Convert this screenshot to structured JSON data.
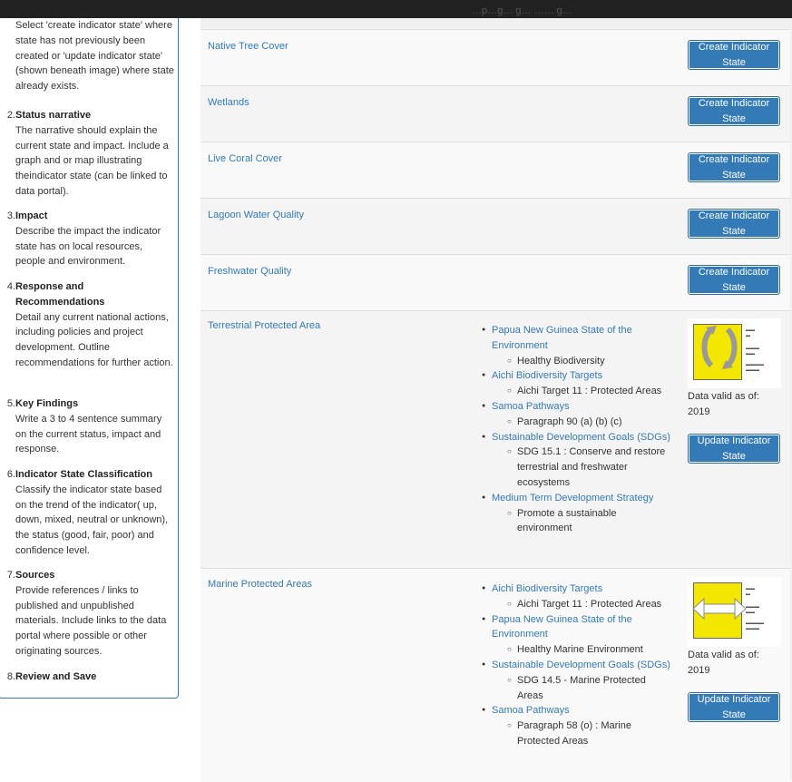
{
  "topbar": {
    "faint_text": "…p…g… g… …… g…"
  },
  "steps": [
    {
      "num": "",
      "title": "",
      "desc": "Select 'create indicator state' where state has not previously been created or 'update indicator state' (shown beneath image) where state already exists."
    },
    {
      "num": "2.",
      "title": "Status narrative",
      "desc": "The narrative should explain the current state and impact. Include a graph and or map illustrating theindicator state (can be linked to data portal)."
    },
    {
      "num": "3.",
      "title": "Impact",
      "desc": "Describe the impact the indicator state has on local resources, people and environment."
    },
    {
      "num": "4.",
      "title": "Response and Recommendations",
      "desc": "Detail any current national actions, including policies and project development. Outline recommendations for further action."
    },
    {
      "num": "5.",
      "title": "Key Findings",
      "desc": "Write a 3 to 4 sentence summary on the current status, impact and response."
    },
    {
      "num": "6.",
      "title": "Indicator State Classification",
      "desc": "Classify the indicator state based on the trend of the indicator( up, down, mixed, neutral or unknown), the status (good, fair, poor) and confidence level."
    },
    {
      "num": "7.",
      "title": "Sources",
      "desc": "Provide references / links to published and unpublished materials. Include links to the data portal where possible or other originating sources."
    },
    {
      "num": "8.",
      "title": "Review and Save",
      "desc": ""
    }
  ],
  "indicators": [
    {
      "name": "Native Tree Cover",
      "button": "Create Indicator State"
    },
    {
      "name": "Wetlands",
      "button": "Create Indicator State"
    },
    {
      "name": "Live Coral Cover",
      "button": "Create Indicator State"
    },
    {
      "name": "Lagoon Water Quality",
      "button": "Create Indicator State"
    },
    {
      "name": "Freshwater Quality",
      "button": "Create Indicator State"
    },
    {
      "name": "Terrestrial Protected Area",
      "button": "Update Indicator State",
      "valid_label": "Data valid as of:",
      "valid_year": "2019",
      "thumb_trend": "mixed",
      "targets": [
        {
          "group": "Papua New Guinea State of the Environment",
          "item": "Healthy Biodiversity"
        },
        {
          "group": "Aichi Biodiversity Targets",
          "item": "Aichi Target 11 : Protected Areas"
        },
        {
          "group": "Samoa Pathways",
          "item": "Paragraph 90 (a) (b) (c)"
        },
        {
          "group": "Sustainable Development Goals (SDGs)",
          "item": "SDG 15.1 : Conserve and restore terrestrial and freshwater ecosystems"
        },
        {
          "group": "Medium Term Development Strategy",
          "item": "Promote a sustainable environment"
        }
      ]
    },
    {
      "name": "Marine Protected Areas",
      "button": "Update Indicator State",
      "valid_label": "Data valid as of:",
      "valid_year": "2019",
      "thumb_trend": "neutral",
      "targets": [
        {
          "group": "Aichi Biodiversity Targets",
          "item": "Aichi Target 11 : Protected Areas"
        },
        {
          "group": "Papua New Guinea State of the Environment",
          "item": "Healthy Marine Environment"
        },
        {
          "group": "Sustainable Development Goals (SDGs)",
          "item": "SDG 14.5 - Marine Protected Areas"
        },
        {
          "group": "Samoa Pathways",
          "item": "Paragraph 58 (o) : Marine Protected Areas"
        }
      ]
    }
  ],
  "colors": {
    "link": "#337ab7",
    "button": "#337ab7",
    "thumb_yellow": "#f3e600"
  }
}
